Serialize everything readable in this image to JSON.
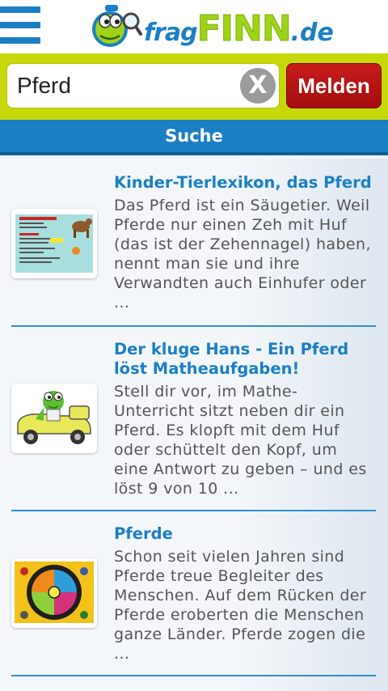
{
  "header": {
    "logo": {
      "frag": "frag",
      "finn": "FINN",
      "de": ".de"
    },
    "menu_icon": "hamburger-menu-icon",
    "mascot_icon": "frog-mascot-magnifier-icon"
  },
  "search": {
    "value": "Pferd",
    "clear_icon": "clear-x-icon",
    "clear_glyph": "X",
    "report_label": "Melden"
  },
  "tab": {
    "label": "Suche"
  },
  "results": [
    {
      "title": "Kinder-Tierlexikon, das Pferd",
      "snippet": "Das Pferd ist ein Säugetier. Weil Pferde nur einen Zeh mit Huf (das ist der Zehennagel) haben, nennt man sie und ihre Verwandten auch Einhufer oder ..."
    },
    {
      "title": "Der kluge Hans - Ein Pferd löst Matheaufgaben!",
      "snippet": "Stell dir vor, im Mathe-Unterricht sitzt neben dir ein Pferd. Es klopft mit dem Huf oder schüttelt den Kopf, um eine Antwort zu geben – und es löst 9 von 10 ..."
    },
    {
      "title": "Pferde",
      "snippet": "Schon seit vielen Jahren sind Pferde treue Begleiter des Menschen. Auf dem Rücken der Pferde eroberten die Menschen ganze Länder. Pferde zogen die ..."
    }
  ],
  "colors": {
    "brand_blue": "#1b7fc4",
    "brand_green": "#9ed317",
    "search_bar": "#c7d80a",
    "report_red": "#b31414"
  }
}
